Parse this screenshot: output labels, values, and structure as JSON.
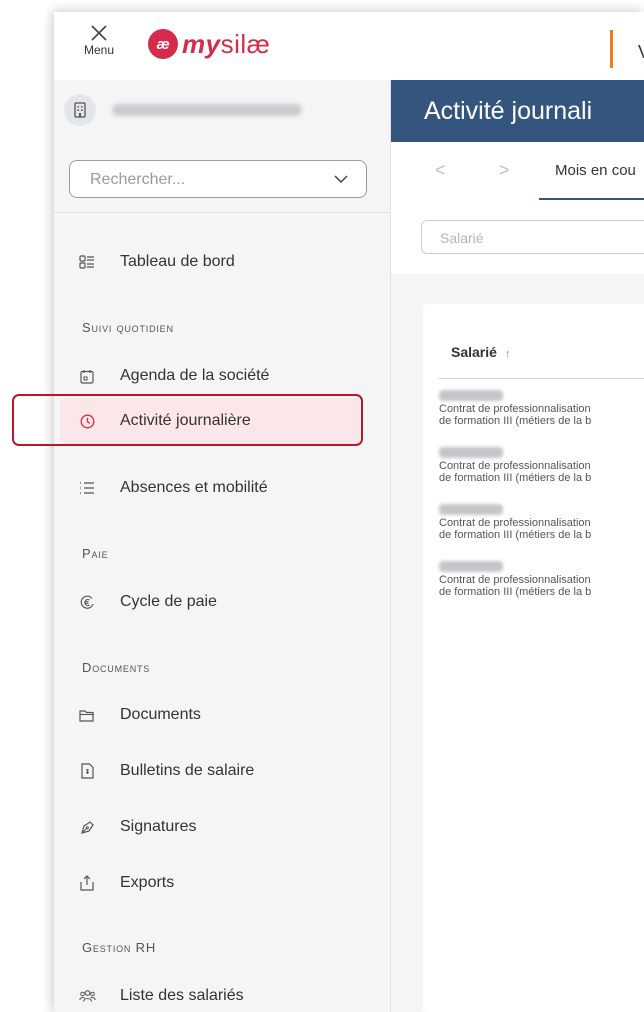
{
  "topbar": {
    "menu_label": "Menu",
    "logo_badge": "æ",
    "logo_my": "my",
    "logo_silae": "silæ",
    "right_cut_text": "V"
  },
  "sidebar": {
    "search_placeholder": "Rechercher...",
    "items": {
      "tableau": "Tableau de bord",
      "agenda": "Agenda de la société",
      "activite": "Activité journalière",
      "absences": "Absences et mobilité",
      "cycle": "Cycle de paie",
      "documents": "Documents",
      "bulletins": "Bulletins de salaire",
      "signatures": "Signatures",
      "exports": "Exports",
      "salaries": "Liste des salariés"
    },
    "sections": {
      "suivi": "Suivi quotidien",
      "paie": "Paie",
      "documents": "Documents",
      "gestion": "Gestion RH"
    }
  },
  "main": {
    "title": "Activité journali",
    "toolbar": {
      "prev": "<",
      "next": ">",
      "month": "Mois en cou"
    },
    "filter_placeholder": "Salarié",
    "table": {
      "column": "Salarié",
      "sort_arrow": "↑",
      "rows": [
        {
          "line1": "Contrat de professionnalisation",
          "line2": "de formation III (métiers de la b"
        },
        {
          "line1": "Contrat de professionnalisation",
          "line2": "de formation III (métiers de la b"
        },
        {
          "line1": "Contrat de professionnalisation",
          "line2": "de formation III (métiers de la b"
        },
        {
          "line1": "Contrat de professionnalisation",
          "line2": "de formation III (métiers de la b"
        }
      ]
    }
  },
  "colors": {
    "brand": "#d62b4a",
    "header": "#34557d",
    "accent_orange": "#f07d1a",
    "highlight": "#b5182b",
    "active_bg": "#fbe7e7"
  }
}
